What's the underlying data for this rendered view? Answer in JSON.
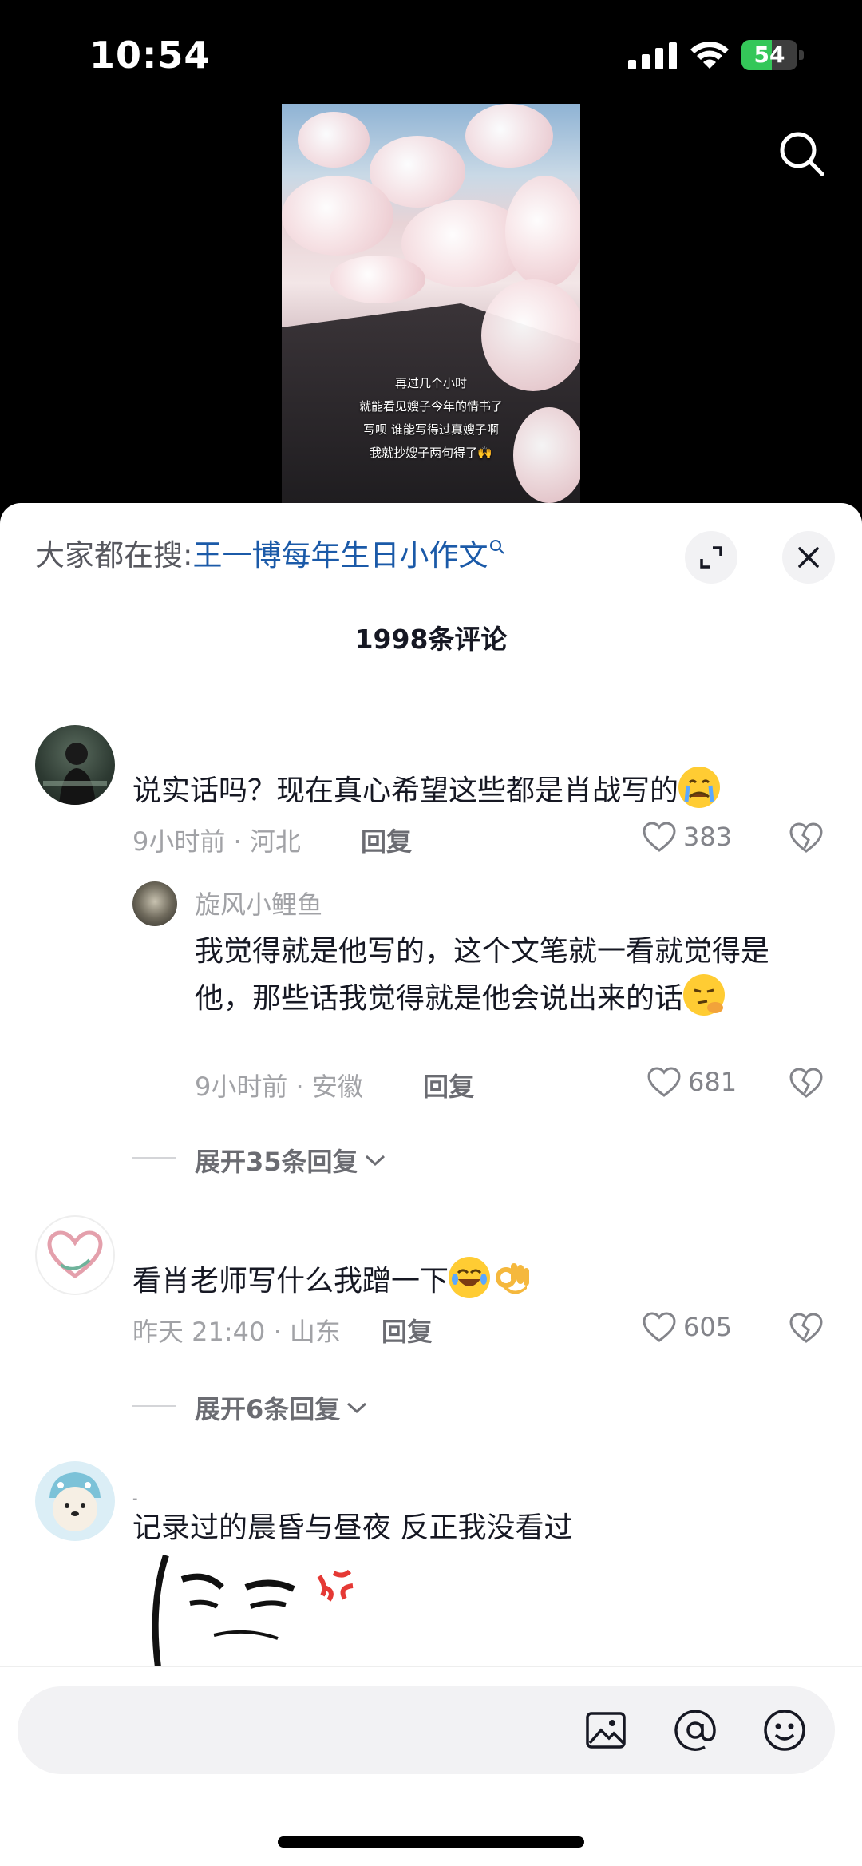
{
  "status": {
    "time": "10:54",
    "battery_percent": "54",
    "battery_level": 0.54
  },
  "video": {
    "caption_lines": [
      "再过几个小时",
      "就能看见嫂子今年的情书了",
      "写呗 谁能写得过真嫂子啊",
      "我就抄嫂子两句得了🙌"
    ]
  },
  "sheet": {
    "hot_search_prefix": "大家都在搜:",
    "hot_search_term": "王一博每年生日小作文",
    "comment_count": "1998条评论"
  },
  "comments": [
    {
      "text": "说实话吗？现在真心希望这些都是肖战写的",
      "meta": "9小时前 · 河北",
      "reply_label": "回复",
      "likes": "383",
      "replies": [
        {
          "name": "旋风小鲤鱼",
          "text": "我觉得就是他写的，这个文笔就一看就觉得是他，那些话我觉得就是他会说出来的话",
          "meta": "9小时前 · 安徽",
          "reply_label": "回复",
          "likes": "681"
        }
      ],
      "expand": "展开35条回复"
    },
    {
      "text": "看肖老师写什么我蹭一下",
      "meta": "昨天 21:40 · 山东",
      "reply_label": "回复",
      "likes": "605",
      "expand": "展开6条回复"
    },
    {
      "name_hint": "-",
      "text": "记录过的晨昏与昼夜 反正我没看过"
    }
  ],
  "input": {
    "placeholder": ""
  }
}
